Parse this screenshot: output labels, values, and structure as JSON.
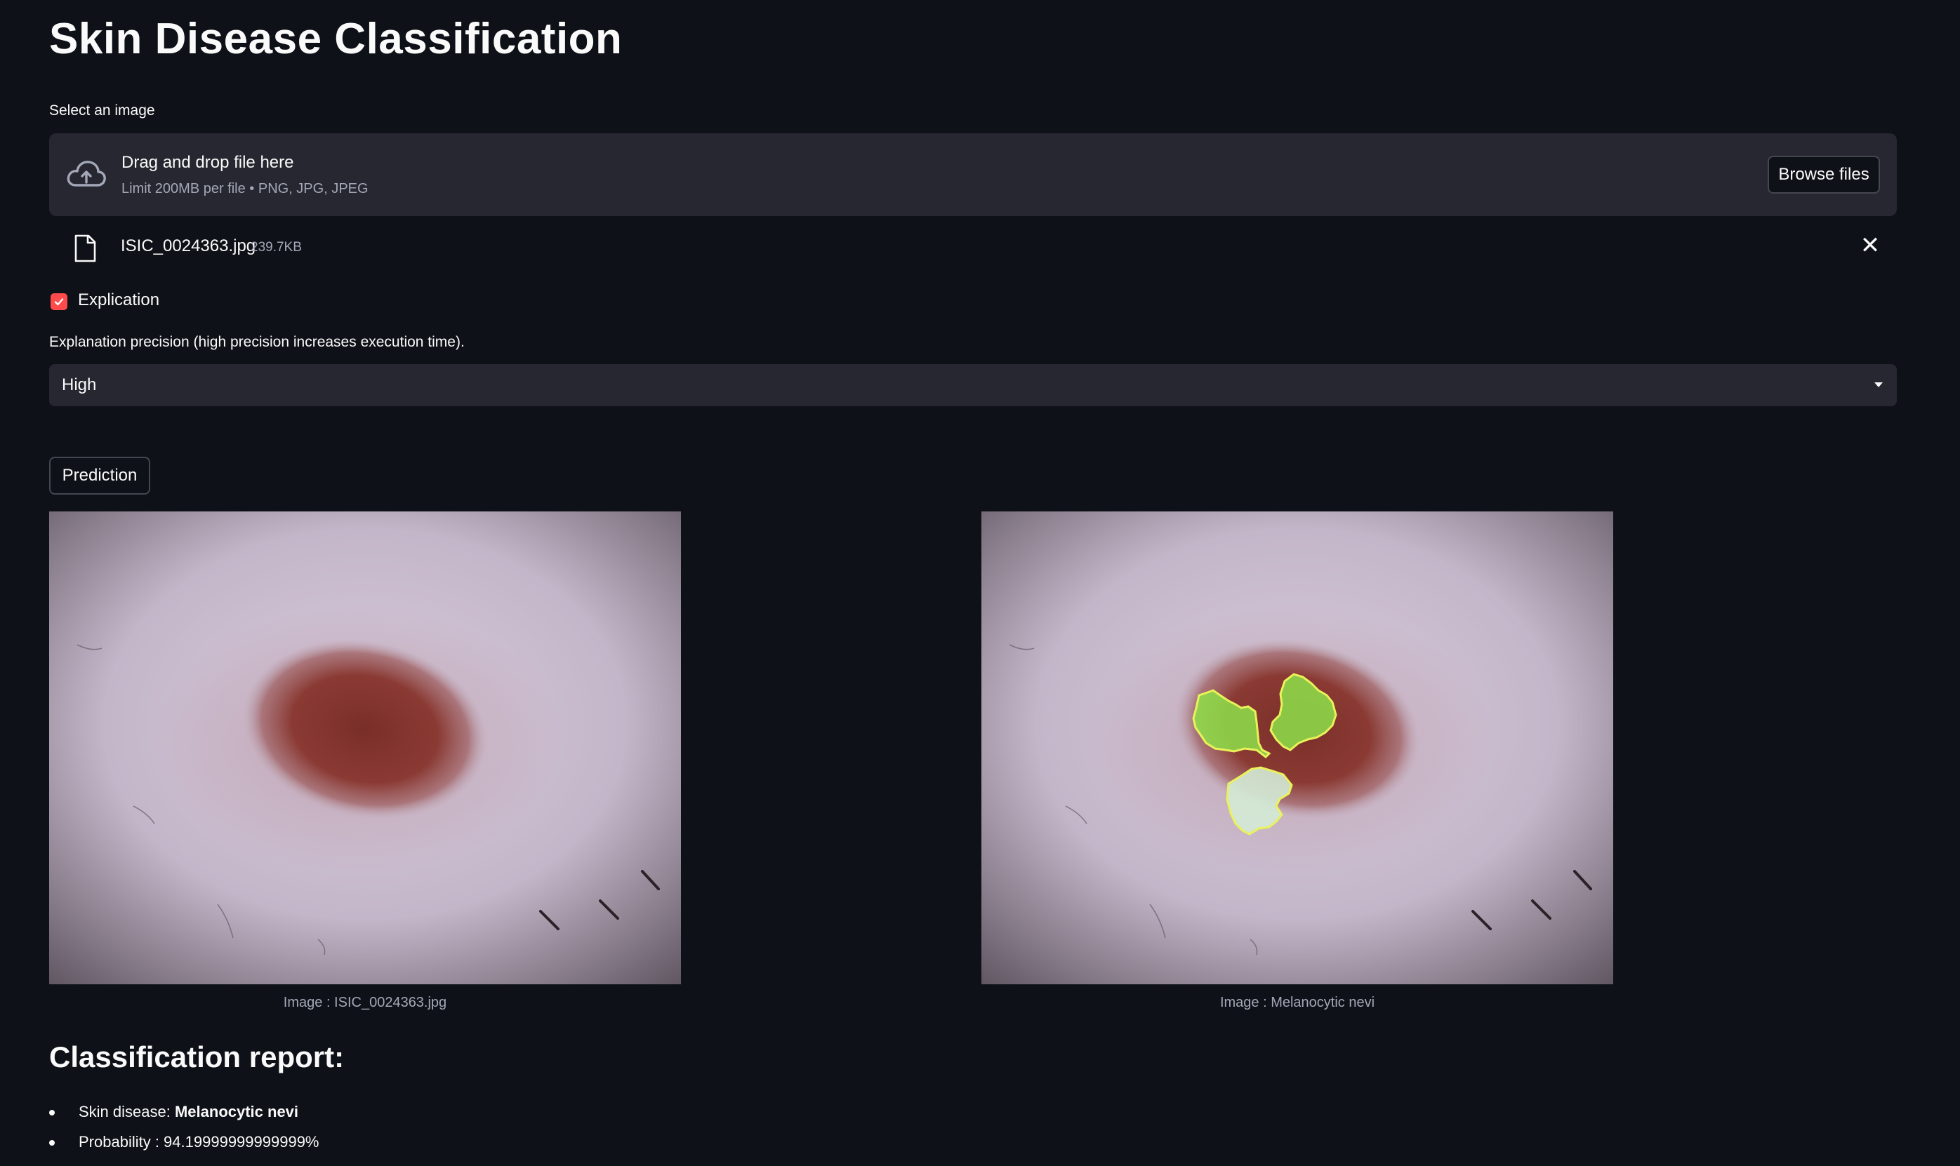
{
  "app": {
    "title": "Skin Disease Classification"
  },
  "uploader": {
    "label": "Select an image",
    "dropzone_title": "Drag and drop file here",
    "dropzone_hint": "Limit 200MB per file • PNG, JPG, JPEG",
    "browse_label": "Browse files",
    "icon": "cloud-upload-icon"
  },
  "uploaded_file": {
    "name": "ISIC_0024363.jpg",
    "size": "239.7KB",
    "icon": "file-icon",
    "remove_icon": "close-icon"
  },
  "explication": {
    "checked": true,
    "label": "Explication"
  },
  "precision": {
    "label": "Explanation precision (high precision increases execution time).",
    "selected": "High"
  },
  "prediction_button": "Prediction",
  "images": {
    "original_caption": "Image : ISIC_0024363.jpg",
    "explained_caption": "Image : Melanocytic nevi"
  },
  "report": {
    "title": "Classification report:",
    "disease_prefix": "Skin disease: ",
    "disease_value": "Melanocytic nevi",
    "probability": "Probability : 94.19999999999999%"
  },
  "colors": {
    "background": "#0e1117",
    "panel": "#262730",
    "accent": "#ff4b4b",
    "highlight": "#8ee04a"
  }
}
